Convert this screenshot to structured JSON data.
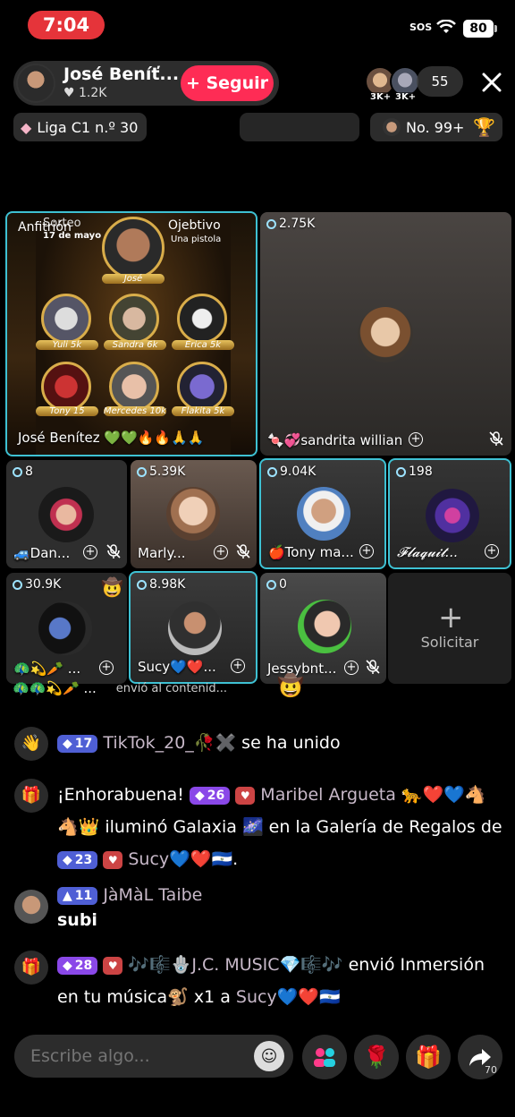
{
  "status_bar": {
    "time": "7:04",
    "sos": "SOS",
    "battery": "80"
  },
  "header": {
    "host_name": "José Beníť...",
    "host_likes": "♥ 1.2K",
    "follow_label": "+ Seguir",
    "viewer_badges": [
      "3K+",
      "3K+"
    ],
    "viewer_count": "55",
    "league": "Liga C1 n.º 30",
    "rank": "No. 99+"
  },
  "host_tile": {
    "label_left": "Anfitrión",
    "poster_title": "Sorteo",
    "poster_date": "17 de mayo",
    "goal_title": "Ojebtivo",
    "goal_sub": "Una pistola",
    "host_caption": "José",
    "circle_labels": [
      "Yuli 5k",
      "Sandra 6k",
      "Erica 5k",
      "Tony 15",
      "Mercedes 10k",
      "Flakita 5k"
    ],
    "name": "José Benítez 💚💚🔥🔥🙏🙏"
  },
  "tiles": [
    {
      "id": "sandrita",
      "views": "2.75K",
      "name": "🍬💞sandrita willian"
    },
    {
      "id": "dan",
      "views": "8",
      "name": "🚙Dan..."
    },
    {
      "id": "marly",
      "views": "5.39K",
      "name": "Marly..."
    },
    {
      "id": "tony",
      "views": "9.04K",
      "name": "🍎Tony ma..."
    },
    {
      "id": "flaquita",
      "views": "198",
      "name": "𝓕𝓵𝓪𝓺𝓾𝓲𝓽..."
    },
    {
      "id": "g1",
      "views": "30.9K",
      "name": "🦚💫🥕 ..."
    },
    {
      "id": "sucy",
      "views": "8.98K",
      "name": "Sucy💙❤️..."
    },
    {
      "id": "jessy",
      "views": "0",
      "name": "Jessybnt..."
    }
  ],
  "request_label": "Solicitar",
  "gift_strip": {
    "sender": "🦚🦚💫🥕 ...",
    "text": "envió al contenid..."
  },
  "chat": [
    {
      "type": "join",
      "level": "17",
      "user": "TikTok_20_🥀✖️",
      "text": "se ha unido"
    },
    {
      "type": "gift",
      "prefix": "¡Enhorabuena!",
      "level": "26",
      "user": "Maribel Argueta 🐆❤️💙🐴🐴👑",
      "mid": "iluminó Galaxia 🌌 en la Galería de Regalos de",
      "level2": "23",
      "user2": "Sucy💙❤️🇸🇻",
      "end": "."
    },
    {
      "type": "comment",
      "level": "11",
      "user": "JàMàL Taibe",
      "text": "subi"
    },
    {
      "type": "gift2",
      "level": "28",
      "user": "🎶🎼🪬J.C. MUSIC💎🎼🎶",
      "mid": "envió Inmersión en tu música🐒 x1 a",
      "user2": "Sucy💙❤️🇸🇻"
    }
  ],
  "input": {
    "placeholder": "Escribe algo..."
  },
  "share_count": "70"
}
